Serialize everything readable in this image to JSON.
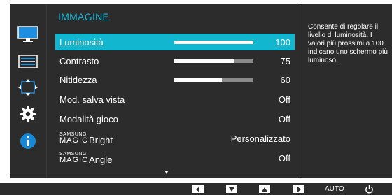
{
  "menu": {
    "title": "IMMAGINE",
    "items": [
      {
        "label": "Luminosità",
        "value": "100",
        "level": 1.0,
        "selected": true,
        "has_bar": true
      },
      {
        "label": "Contrasto",
        "value": "75",
        "level": 0.75,
        "has_bar": true
      },
      {
        "label": "Nitidezza",
        "value": "60",
        "level": 0.6,
        "has_bar": true
      },
      {
        "label": "Mod. salva vista",
        "value": "Off"
      },
      {
        "label": "Modalità gioco",
        "value": "Off"
      },
      {
        "label_prefix_small": "SAMSUNG",
        "label_prefix_big": "MAGIC",
        "label": "Bright",
        "value": "Personalizzato"
      },
      {
        "label_prefix_small": "SAMSUNG",
        "label_prefix_big": "MAGIC",
        "label": "Angle",
        "value": "Off"
      }
    ],
    "scroll_indicator": "▼"
  },
  "side_icons": [
    "picture-icon",
    "osd-adjust-icon",
    "position-icon",
    "setup-gear-icon",
    "information-icon"
  ],
  "help": {
    "text": "Consente di regolare il livello di luminosità. I valori più prossimi a 100 indicano uno schermo più luminoso."
  },
  "keys": {
    "left": "◀",
    "down": "▼",
    "up": "▲",
    "right": "▶",
    "auto": "AUTO",
    "power_icon": "power-icon"
  },
  "colors": {
    "panel": "#2c2c2c",
    "accent": "#13b6cf",
    "title": "#16b7d6",
    "bar_track": "#8a8a8a",
    "info_blue": "#1689d6"
  }
}
